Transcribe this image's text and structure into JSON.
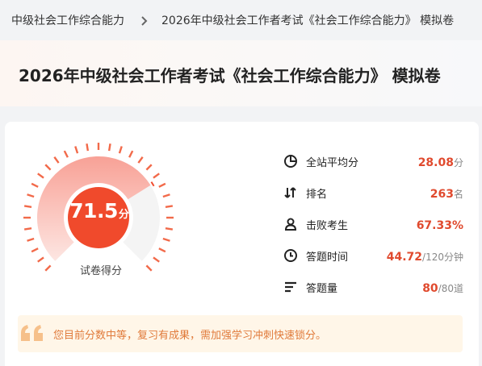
{
  "breadcrumb": {
    "items": [
      "中级社会工作综合能力",
      "2026年中级社会工作者考试《社会工作综合能力》 模拟卷"
    ],
    "separator_icon": "chevron-right-icon"
  },
  "header": {
    "title": "2026年中级社会工作者考试《社会工作综合能力》 模拟卷"
  },
  "score": {
    "value": "71.5",
    "unit": "分",
    "label": "试卷得分",
    "fraction": 0.715,
    "colors": {
      "accent": "#f04a2c",
      "arc_light": "#fbd3cb",
      "track": "#f4f4f4"
    }
  },
  "stats": [
    {
      "icon": "pie-chart-icon",
      "label": "全站平均分",
      "value": "28.08",
      "unit": "分"
    },
    {
      "icon": "sort-arrows-icon",
      "label": "排名",
      "value": "263",
      "unit": "名"
    },
    {
      "icon": "user-icon",
      "label": "击败考生",
      "value": "67.33%",
      "unit": ""
    },
    {
      "icon": "clock-icon",
      "label": "答题时间",
      "value": "44.72",
      "unit": "/120分钟"
    },
    {
      "icon": "list-icon",
      "label": "答题量",
      "value": "80",
      "unit": "/80道"
    }
  ],
  "advice": {
    "icon": "quote-icon",
    "text": "您目前分数中等，复习有成果，需加强学习冲刺快速锁分。"
  }
}
